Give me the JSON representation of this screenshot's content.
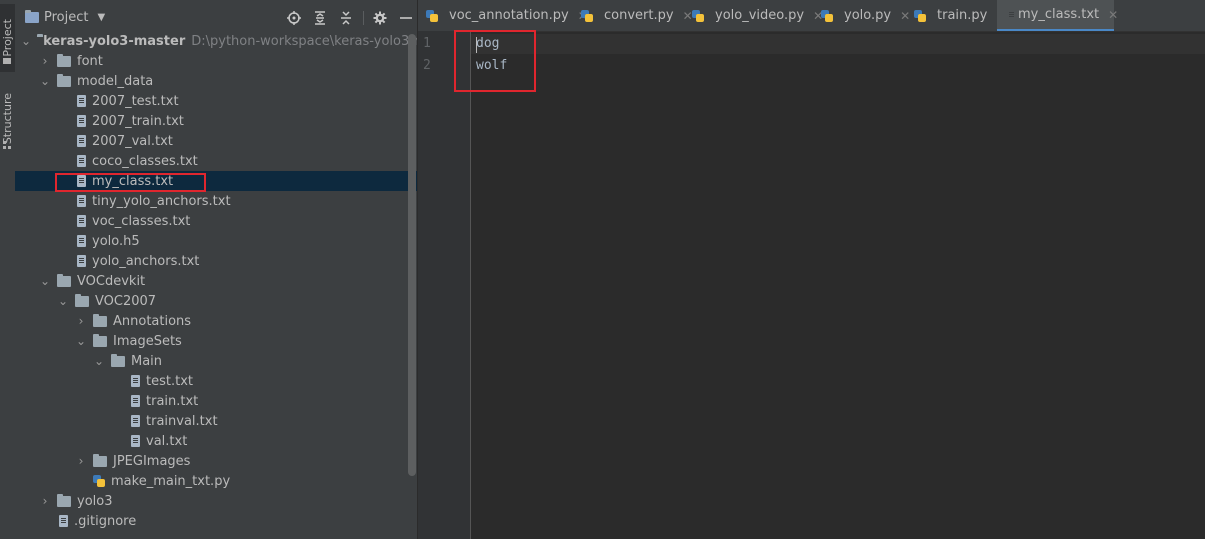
{
  "toolstrip": {
    "project_label": "Project",
    "structure_label": "Structure"
  },
  "project_panel": {
    "title": "Project",
    "tools": [
      "crosshair-icon",
      "expand-all-icon",
      "collapse-all-icon",
      "gear-icon",
      "minimize-icon"
    ],
    "tree": {
      "root_name": "keras-yolo3-master",
      "root_path": "D:\\python-workspace\\keras-yolo3-maste",
      "items": [
        {
          "label": "font",
          "type": "folder",
          "expanded": false
        },
        {
          "label": "model_data",
          "type": "folder",
          "expanded": true
        },
        {
          "label": "2007_test.txt",
          "type": "file"
        },
        {
          "label": "2007_train.txt",
          "type": "file"
        },
        {
          "label": "2007_val.txt",
          "type": "file"
        },
        {
          "label": "coco_classes.txt",
          "type": "file"
        },
        {
          "label": "my_class.txt",
          "type": "file",
          "selected": true
        },
        {
          "label": "tiny_yolo_anchors.txt",
          "type": "file"
        },
        {
          "label": "voc_classes.txt",
          "type": "file"
        },
        {
          "label": "yolo.h5",
          "type": "file"
        },
        {
          "label": "yolo_anchors.txt",
          "type": "file"
        },
        {
          "label": "VOCdevkit",
          "type": "folder",
          "expanded": true
        },
        {
          "label": "VOC2007",
          "type": "folder",
          "expanded": true
        },
        {
          "label": "Annotations",
          "type": "folder",
          "expanded": false
        },
        {
          "label": "ImageSets",
          "type": "folder",
          "expanded": true
        },
        {
          "label": "Main",
          "type": "folder",
          "expanded": true
        },
        {
          "label": "test.txt",
          "type": "file"
        },
        {
          "label": "train.txt",
          "type": "file"
        },
        {
          "label": "trainval.txt",
          "type": "file"
        },
        {
          "label": "val.txt",
          "type": "file"
        },
        {
          "label": "JPEGImages",
          "type": "folder",
          "expanded": false
        },
        {
          "label": "make_main_txt.py",
          "type": "python"
        },
        {
          "label": "yolo3",
          "type": "folder",
          "expanded": false
        },
        {
          "label": ".gitignore",
          "type": "file"
        }
      ]
    }
  },
  "editor": {
    "tabs": [
      {
        "label": "voc_annotation.py",
        "type": "python"
      },
      {
        "label": "convert.py",
        "type": "python"
      },
      {
        "label": "yolo_video.py",
        "type": "python"
      },
      {
        "label": "yolo.py",
        "type": "python"
      },
      {
        "label": "train.py",
        "type": "python"
      },
      {
        "label": "my_class.txt",
        "type": "text",
        "active": true
      }
    ],
    "line_numbers": [
      "1",
      "2"
    ],
    "lines": [
      "dog",
      "wolf"
    ]
  },
  "colors": {
    "highlight_box": "#e0262e",
    "selection": "#0d293e",
    "active_tab_underline": "#4a88c7"
  }
}
